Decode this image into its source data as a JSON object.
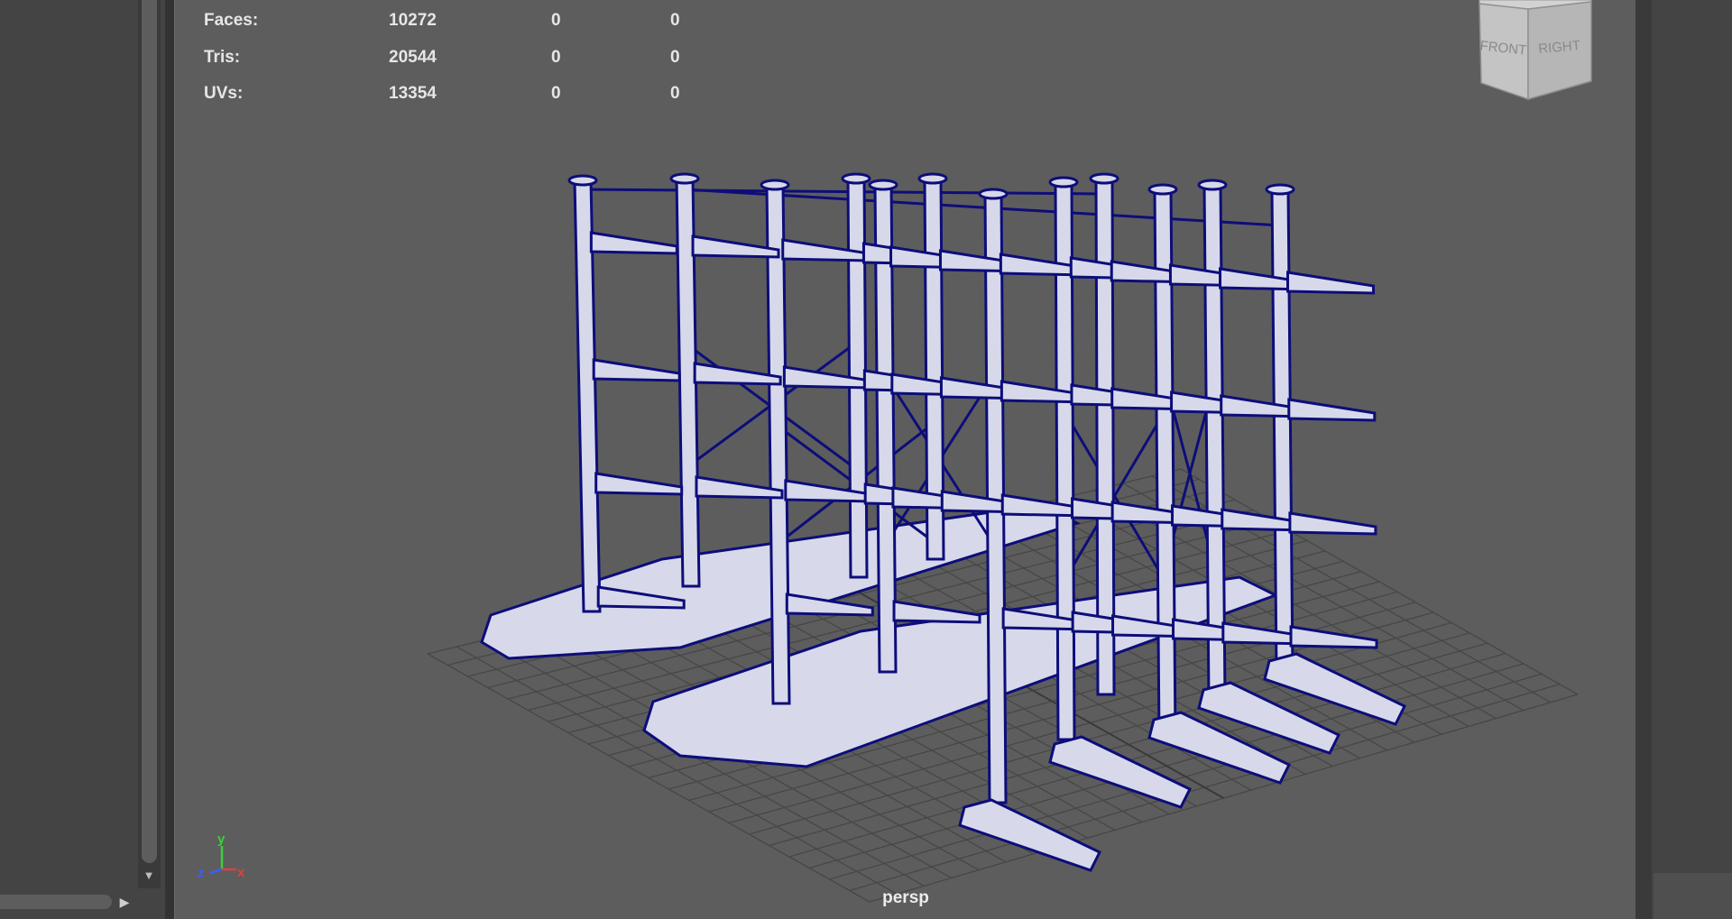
{
  "hud": {
    "rows": [
      {
        "label": "Faces:",
        "v1": "10272",
        "v2": "0",
        "v3": "0"
      },
      {
        "label": "Tris:",
        "v1": "20544",
        "v2": "0",
        "v3": "0"
      },
      {
        "label": "UVs:",
        "v1": "13354",
        "v2": "0",
        "v3": "0"
      }
    ]
  },
  "viewcube": {
    "front_label": "FRONT",
    "right_label": "RIGHT"
  },
  "axis": {
    "y": "y",
    "z": "z",
    "x": "x",
    "y_color": "#3ccf3c",
    "z_color": "#3c5cff",
    "x_color": "#e0403c"
  },
  "camera": {
    "name": "persp"
  },
  "colors": {
    "wire": "#0d0d7a",
    "mesh": "#d7d9ea",
    "grid": "#4a4a4a",
    "viewport_bg": "#5d5d5d"
  },
  "icons": {
    "scroll_down": "triangle-down-icon",
    "scroll_right": "triangle-right-icon"
  }
}
